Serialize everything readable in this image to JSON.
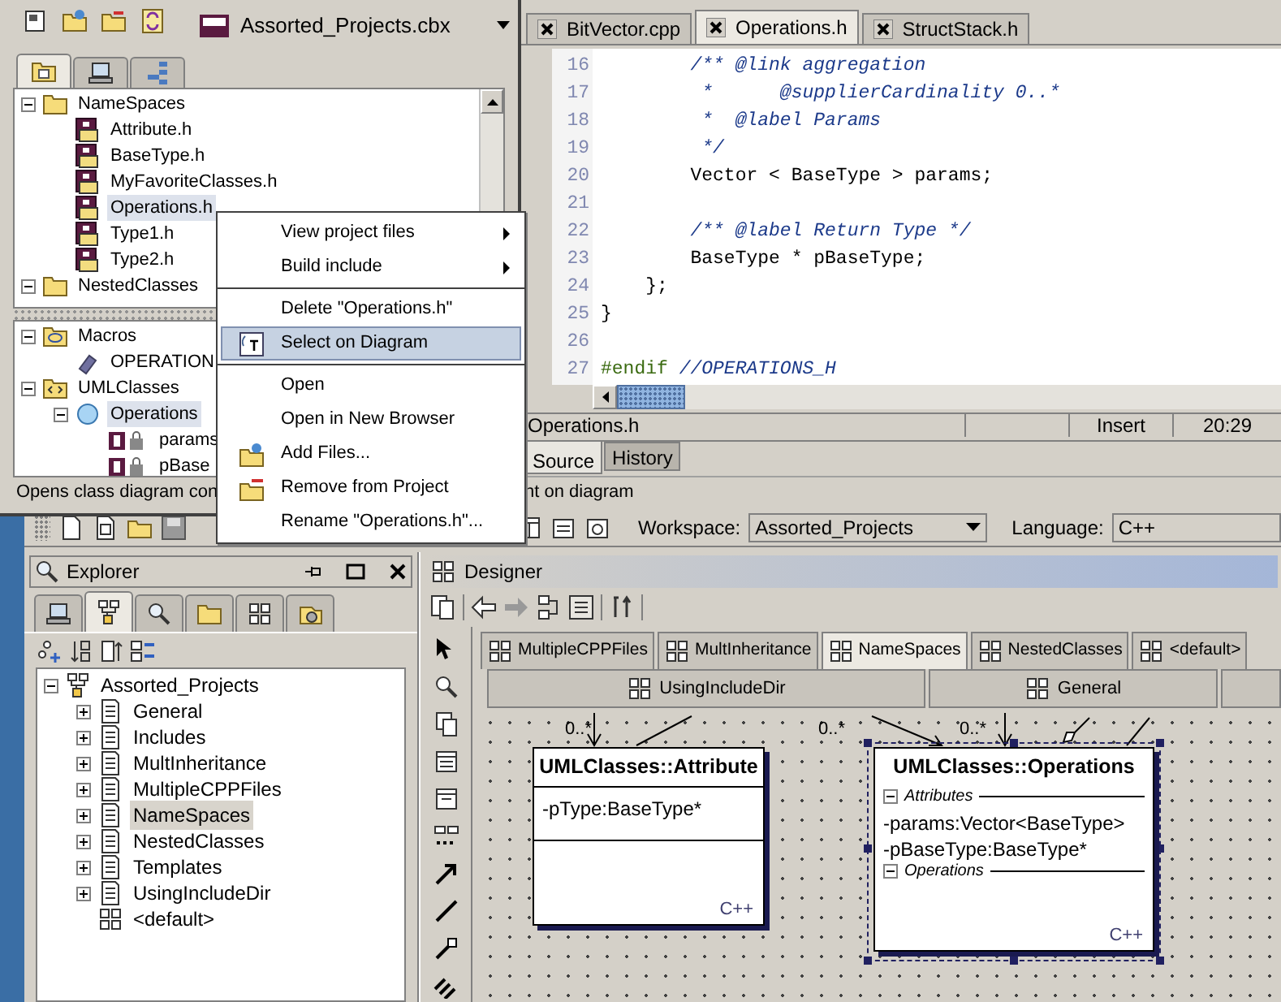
{
  "project_window": {
    "combo": "Assorted_Projects.cbx",
    "tabs": [
      {
        "kind": "files",
        "selected": true
      },
      {
        "kind": "computer",
        "selected": false
      },
      {
        "kind": "structure",
        "selected": false
      }
    ],
    "tree": [
      {
        "label": "NameSpaces",
        "kind": "folder",
        "expanded": true,
        "selected": false,
        "children": [
          {
            "label": "Attribute.h",
            "kind": "header",
            "selected": false
          },
          {
            "label": "BaseType.h",
            "kind": "header",
            "selected": false
          },
          {
            "label": "MyFavoriteClasses.h",
            "kind": "header",
            "selected": false
          },
          {
            "label": "Operations.h",
            "kind": "header",
            "selected": true
          },
          {
            "label": "Type1.h",
            "kind": "header",
            "selected": false
          },
          {
            "label": "Type2.h",
            "kind": "header",
            "selected": false
          }
        ]
      },
      {
        "label": "NestedClasses",
        "kind": "folder",
        "expanded": true,
        "selected": false
      }
    ],
    "lower_tree": [
      {
        "label": "Macros",
        "kind": "macro-folder",
        "expanded": true,
        "selected": false,
        "children": [
          {
            "label": "OPERATION",
            "kind": "macro",
            "selected": false
          }
        ]
      },
      {
        "label": "UMLClasses",
        "kind": "class-folder",
        "expanded": true,
        "selected": false,
        "children": [
          {
            "label": "Operations",
            "kind": "class",
            "expanded": true,
            "selected": true,
            "children": [
              {
                "label": "params",
                "kind": "field",
                "selected": false
              },
              {
                "label": "pBase",
                "kind": "field",
                "selected": false
              }
            ]
          }
        ]
      }
    ],
    "status": "Opens class diagram con"
  },
  "context_menu": [
    {
      "kind": "plain",
      "label": "View project files",
      "submenu": true,
      "selected": false
    },
    {
      "kind": "plain",
      "label": "Build include",
      "submenu": true,
      "selected": false
    },
    {
      "kind": "separator"
    },
    {
      "kind": "plain",
      "label": "Delete \"Operations.h\"",
      "submenu": false,
      "selected": false
    },
    {
      "kind": "select",
      "label": "Select on Diagram",
      "submenu": false,
      "selected": true
    },
    {
      "kind": "separator"
    },
    {
      "kind": "plain",
      "label": "Open",
      "submenu": false,
      "selected": false
    },
    {
      "kind": "plain",
      "label": "Open in New Browser",
      "submenu": false,
      "selected": false
    },
    {
      "kind": "add",
      "label": "Add Files...",
      "submenu": false,
      "selected": false
    },
    {
      "kind": "remove",
      "label": "Remove from Project",
      "submenu": false,
      "selected": false
    },
    {
      "kind": "plain",
      "label": "Rename \"Operations.h\"...",
      "submenu": false,
      "selected": false
    }
  ],
  "editor": {
    "tabs": [
      {
        "label": "BitVector.cpp",
        "selected": false
      },
      {
        "label": "Operations.h",
        "selected": true
      },
      {
        "label": "StructStack.h",
        "selected": false
      }
    ],
    "lines": [
      {
        "number": "16",
        "segments": [
          {
            "kind": "comment",
            "text": "        /** @link aggregation"
          }
        ]
      },
      {
        "number": "17",
        "segments": [
          {
            "kind": "comment",
            "text": "         *      @supplierCardinality 0..*"
          }
        ]
      },
      {
        "number": "18",
        "segments": [
          {
            "kind": "comment",
            "text": "         *  @label Params"
          }
        ]
      },
      {
        "number": "19",
        "segments": [
          {
            "kind": "comment",
            "text": "         */"
          }
        ]
      },
      {
        "number": "20",
        "segments": [
          {
            "kind": "code",
            "text": "        Vector < BaseType > params;"
          }
        ]
      },
      {
        "number": "21"
      },
      {
        "number": "22",
        "segments": [
          {
            "kind": "comment",
            "text": "        /** @label Return Type */"
          }
        ]
      },
      {
        "number": "23",
        "segments": [
          {
            "kind": "code",
            "text": "        BaseType * pBaseType;"
          }
        ]
      },
      {
        "number": "24",
        "segments": [
          {
            "kind": "code",
            "text": "    };"
          }
        ]
      },
      {
        "number": "25",
        "segments": [
          {
            "kind": "code",
            "text": "}"
          }
        ]
      },
      {
        "number": "26"
      },
      {
        "number": "27",
        "segments": [
          {
            "kind": "preprocessor",
            "text": "#endif"
          },
          {
            "kind": "comment",
            "text": " //OPERATIONS_H"
          }
        ]
      }
    ],
    "status": {
      "file": "Operations.h",
      "mode": "Insert",
      "position": "20:29"
    },
    "view_tabs": [
      {
        "label": "Source",
        "selected": true
      },
      {
        "label": "History",
        "selected": false
      }
    ]
  },
  "main_status": "nt on diagram",
  "workspace_bar": {
    "workspace_label": "Workspace:",
    "workspace": "Assorted_Projects",
    "language_label": "Language:",
    "language": "C++"
  },
  "explorer": {
    "title": "Explorer",
    "tabs": [
      {
        "kind": "computer",
        "selected": false
      },
      {
        "kind": "hierarchy",
        "selected": true
      },
      {
        "kind": "search",
        "selected": false
      },
      {
        "kind": "folder",
        "selected": false
      },
      {
        "kind": "diagram",
        "selected": false
      },
      {
        "kind": "tools",
        "selected": false
      }
    ],
    "tree": [
      {
        "label": "Assorted_Projects",
        "kind": "project",
        "expanded": true,
        "selected": false,
        "children": [
          {
            "label": "General",
            "kind": "package",
            "expanded": false,
            "selected": false
          },
          {
            "label": "Includes",
            "kind": "package",
            "expanded": false,
            "selected": false
          },
          {
            "label": "MultInheritance",
            "kind": "package",
            "expanded": false,
            "selected": false
          },
          {
            "label": "MultipleCPPFiles",
            "kind": "package",
            "expanded": false,
            "selected": false
          },
          {
            "label": "NameSpaces",
            "kind": "package",
            "expanded": false,
            "selected": true
          },
          {
            "label": "NestedClasses",
            "kind": "package",
            "expanded": false,
            "selected": false
          },
          {
            "label": "Templates",
            "kind": "package",
            "expanded": false,
            "selected": false
          },
          {
            "label": "UsingIncludeDir",
            "kind": "package",
            "expanded": false,
            "selected": false
          },
          {
            "label": "<default>",
            "kind": "diagram",
            "selected": false
          }
        ]
      }
    ]
  },
  "designer": {
    "title": "Designer",
    "tabs": [
      {
        "label": "MultipleCPPFiles",
        "selected": false
      },
      {
        "label": "MultInheritance",
        "selected": false
      },
      {
        "label": "NameSpaces",
        "selected": true
      },
      {
        "label": "NestedClasses",
        "selected": false
      },
      {
        "label": "<default>",
        "selected": false
      }
    ],
    "tabs_row_2": [
      {
        "label": "UsingIncludeDir",
        "selected": false
      },
      {
        "label": "General",
        "selected": false
      }
    ],
    "multiplicities": [
      "0..*",
      "0..*",
      "0..*"
    ],
    "classes": [
      {
        "kind": "plain",
        "name": "UMLClasses::Attribute",
        "selected": false,
        "attributes": [
          "-pType:BaseType*"
        ],
        "language": "C++"
      },
      {
        "kind": "sectioned",
        "name": "UMLClasses::Operations",
        "selected": true,
        "attributes_header": "Attributes",
        "attributes": [
          "-params:Vector<BaseType>",
          "-pBaseType:BaseType*"
        ],
        "operations_header": "Operations",
        "language": "C++"
      }
    ]
  }
}
